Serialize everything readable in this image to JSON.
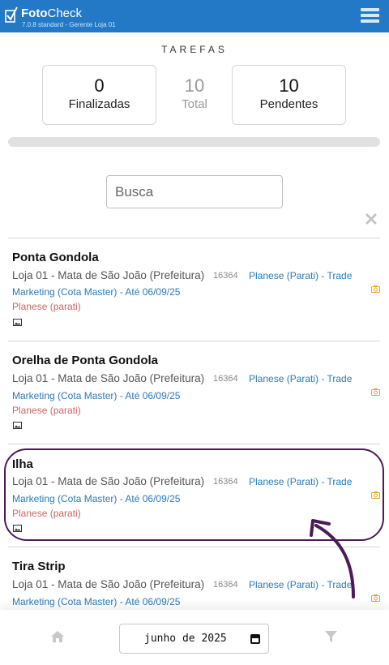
{
  "header": {
    "brand_bold": "Foto",
    "brand_rest": "Check",
    "version": "7.0.8 standard - Gerente Loja 01",
    "menu_icon": "hamburger-menu-icon",
    "accent_color": "#2379c6"
  },
  "summary": {
    "title": "TAREFAS",
    "finalizadas_value": "0",
    "finalizadas_label": "Finalizadas",
    "total_value": "10",
    "total_label": "Total",
    "pendentes_value": "10",
    "pendentes_label": "Pendentes",
    "progress_fraction": 0.0
  },
  "search": {
    "placeholder": "Busca",
    "clear_icon": "close-icon"
  },
  "tasks": [
    {
      "title": "Ponta Gondola",
      "location": "Loja 01 - Mata de São João (Prefeitura)",
      "code": "16364",
      "tag_line1": "Planese (Parati) - Trade",
      "tag_line2": "Marketing (Cota Master) - Até 06/09/25",
      "subtitle": "Planese (parati)"
    },
    {
      "title": "Orelha de Ponta Gondola",
      "location": "Loja 01 - Mata de São João (Prefeitura)",
      "code": "16364",
      "tag_line1": "Planese (Parati) - Trade",
      "tag_line2": "Marketing (Cota Master) - Até 06/09/25",
      "subtitle": "Planese (parati)"
    },
    {
      "title": "Ilha",
      "location": "Loja 01 - Mata de São João (Prefeitura)",
      "code": "16364",
      "tag_line1": "Planese (Parati) - Trade",
      "tag_line2": "Marketing (Cota Master) - Até 06/09/25",
      "subtitle": "Planese (parati)"
    },
    {
      "title": "Tira Strip",
      "location": "Loja 01 - Mata de São João (Prefeitura)",
      "code": "16364",
      "tag_line1": "Planese (Parati) - Trade",
      "tag_line2": "Marketing (Cota Master) - Até 06/09/25",
      "subtitle": ""
    }
  ],
  "footer": {
    "home_icon": "home-icon",
    "month_value": "junho de 2025",
    "calendar_icon": "calendar-icon",
    "filter_icon": "filter-icon"
  }
}
